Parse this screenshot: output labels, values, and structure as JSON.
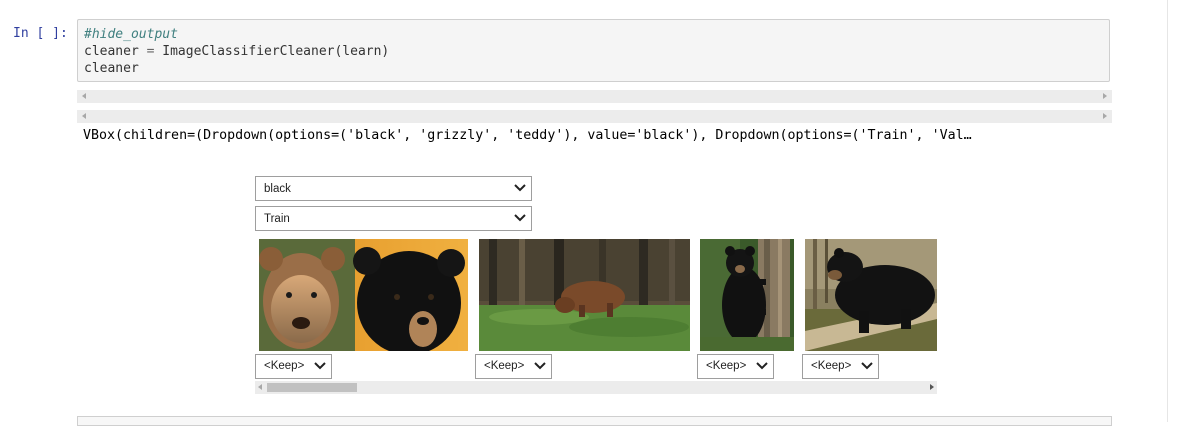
{
  "notebook": {
    "prompt": "In [ ]:",
    "code_lines": {
      "line1": "#hide_output",
      "line2_var": "cleaner",
      "line2_op": " = ",
      "line2_call": "ImageClassifierCleaner(learn)",
      "line3": "cleaner"
    },
    "output_repr": "VBox(children=(Dropdown(options=('black', 'grizzly', 'teddy'), value='black'), Dropdown(options=('Train', 'Val…"
  },
  "widget": {
    "category_dropdown": {
      "value": "black",
      "options": [
        "black",
        "grizzly",
        "teddy"
      ]
    },
    "split_dropdown": {
      "value": "Train",
      "options": [
        "Train",
        "Valid"
      ]
    },
    "images": [
      {
        "subject": "grizzly and black bear faces",
        "action": "<Keep>"
      },
      {
        "subject": "brown bear grazing in forest",
        "action": "<Keep>"
      },
      {
        "subject": "black bear climbing tree",
        "action": "<Keep>"
      },
      {
        "subject": "black bear standing on log",
        "action": "<Keep>"
      }
    ]
  },
  "icons": {
    "dropdown": "chevron-down-icon",
    "scroll_left": "scroll-left-arrow-icon",
    "scroll_right": "scroll-right-arrow-icon"
  },
  "colors": {
    "prompt": "#303f9f",
    "code_background": "#f5f5f5",
    "comment": "#408080"
  }
}
